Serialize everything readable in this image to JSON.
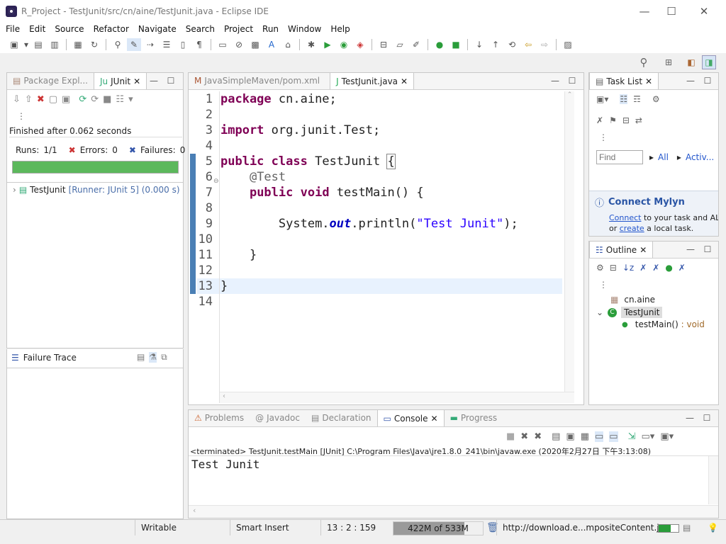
{
  "window": {
    "title": "R_Project - TestJunit/src/cn/aine/TestJunit.java - Eclipse IDE",
    "minimize": "—",
    "maximize": "☐",
    "close": "✕"
  },
  "menu": [
    "File",
    "Edit",
    "Source",
    "Refactor",
    "Navigate",
    "Search",
    "Project",
    "Run",
    "Window",
    "Help"
  ],
  "junit": {
    "tabs": {
      "package_explorer": "Package Expl...",
      "junit": "JUnit"
    },
    "finished": "Finished after 0.062 seconds",
    "runs_label": "Runs:",
    "runs_value": "1/1",
    "errors_label": "Errors:",
    "errors_value": "0",
    "failures_label": "Failures:",
    "failures_value": "0",
    "progress": 1.0,
    "tree_item": "TestJunit",
    "tree_detail": "[Runner: JUnit 5] (0.000 s)",
    "failure_trace": "Failure Trace"
  },
  "editor": {
    "tabs": [
      {
        "label": "JavaSimpleMaven/pom.xml"
      },
      {
        "label": "TestJunit.java"
      }
    ],
    "line_numbers": [
      "1",
      "2",
      "3",
      "4",
      "5",
      "6",
      "7",
      "8",
      "9",
      "10",
      "11",
      "12",
      "13",
      "14"
    ],
    "code": {
      "l1_kw": "package",
      "l1_rest": " cn.aine;",
      "l3_kw": "import",
      "l3_rest": " org.junit.Test;",
      "l5_kw1": "public",
      "l5_kw2": "class",
      "l5_rest": " TestJunit ",
      "l5_brace": "{",
      "l6_ann": "@Test",
      "l7_kw1": "public",
      "l7_kw2": "void",
      "l7_rest": " testMain() {",
      "l9_pre": "System.",
      "l9_field": "out",
      "l9_mid": ".println(",
      "l9_str": "\"Test Junit\"",
      "l9_end": ");",
      "l11": "}",
      "l13": "}"
    }
  },
  "tasklist": {
    "tab": "Task List",
    "find_placeholder": "Find",
    "all": "All",
    "activate": "Activ...",
    "mylyn_title": "Connect Mylyn",
    "mylyn_connect": "Connect",
    "mylyn_text1": " to your task and ALM",
    "mylyn_or": "or ",
    "mylyn_create": "create",
    "mylyn_text2": " a local task."
  },
  "outline": {
    "tab": "Outline",
    "package": "cn.aine",
    "class": "TestJunit",
    "method": "testMain()",
    "method_type": " : void"
  },
  "console": {
    "tabs": [
      {
        "label": "Problems"
      },
      {
        "label": "Javadoc"
      },
      {
        "label": "Declaration"
      },
      {
        "label": "Console"
      },
      {
        "label": "Progress"
      }
    ],
    "terminated": "<terminated> TestJunit.testMain [JUnit] C:\\Program Files\\Java\\jre1.8.0_241\\bin\\javaw.exe (2020年2月27日 下午3:13:08)",
    "output": "Test Junit"
  },
  "status": {
    "writable": "Writable",
    "insert": "Smart Insert",
    "position": "13 : 2 : 159",
    "heap": "422M of 533M",
    "heap_fraction": 0.79,
    "url": "http://download.e...mpositeContent.jar"
  },
  "colors": {
    "junit_green": "#5cb85c",
    "keyword": "#7f0055",
    "string": "#2a00ff",
    "link": "#2255cc"
  }
}
